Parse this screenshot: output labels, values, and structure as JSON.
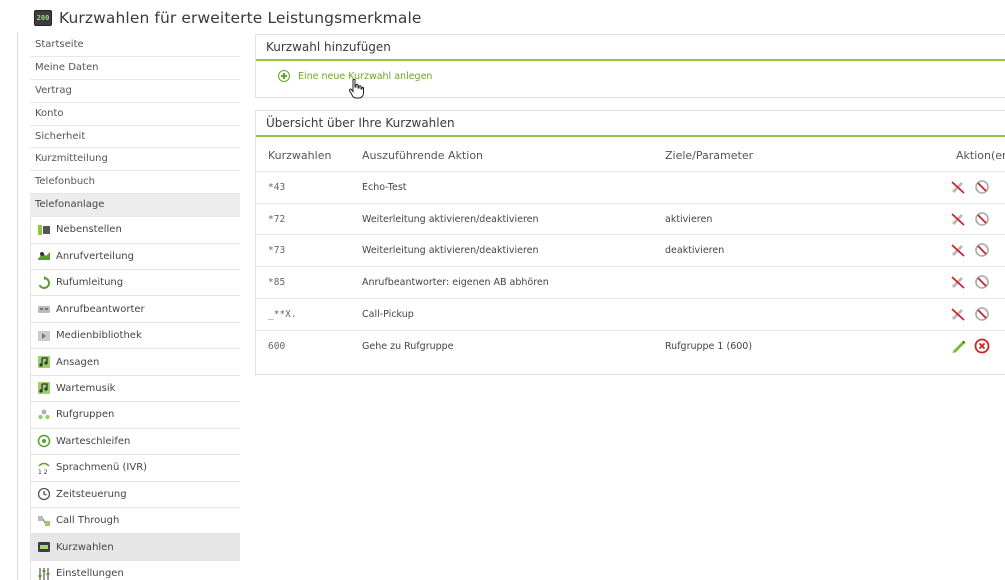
{
  "page": {
    "icon_text": "200",
    "title": "Kurzwahlen für erweiterte Leistungsmerkmale"
  },
  "sidebar": {
    "items": [
      {
        "label": "Startseite"
      },
      {
        "label": "Meine Daten"
      },
      {
        "label": "Vertrag"
      },
      {
        "label": "Konto"
      },
      {
        "label": "Sicherheit"
      },
      {
        "label": "Kurzmitteilung"
      },
      {
        "label": "Telefonbuch"
      },
      {
        "label": "Telefonanlage"
      }
    ],
    "sub_items": [
      {
        "label": "Nebenstellen",
        "icon": "extension-icon"
      },
      {
        "label": "Anrufverteilung",
        "icon": "call-distribution-icon"
      },
      {
        "label": "Rufumleitung",
        "icon": "call-forwarding-icon"
      },
      {
        "label": "Anrufbeantworter",
        "icon": "answering-machine-icon"
      },
      {
        "label": "Medienbibliothek",
        "icon": "media-library-icon"
      },
      {
        "label": "Ansagen",
        "icon": "announcement-icon"
      },
      {
        "label": "Wartemusik",
        "icon": "hold-music-icon"
      },
      {
        "label": "Rufgruppen",
        "icon": "call-group-icon"
      },
      {
        "label": "Warteschleifen",
        "icon": "queue-icon"
      },
      {
        "label": "Sprachmenü (IVR)",
        "icon": "ivr-icon"
      },
      {
        "label": "Zeitsteuerung",
        "icon": "clock-icon"
      },
      {
        "label": "Call Through",
        "icon": "call-through-icon"
      },
      {
        "label": "Kurzwahlen",
        "icon": "speed-dial-icon"
      },
      {
        "label": "Einstellungen",
        "icon": "settings-icon"
      }
    ],
    "active_sub": "Kurzwahlen"
  },
  "add_panel": {
    "title": "Kurzwahl hinzufügen",
    "add_link": "Eine neue Kurzwahl anlegen"
  },
  "list_panel": {
    "title": "Übersicht über Ihre Kurzwahlen",
    "headers": [
      "Kurzwahlen",
      "Auszuführende Aktion",
      "Ziele/Parameter",
      "Aktion(en)"
    ],
    "rows": [
      {
        "code": "*43",
        "action": "Echo-Test",
        "param": "",
        "editable": false
      },
      {
        "code": "*72",
        "action": "Weiterleitung aktivieren/deaktivieren",
        "param": "aktivieren",
        "editable": false
      },
      {
        "code": "*73",
        "action": "Weiterleitung aktivieren/deaktivieren",
        "param": "deaktivieren",
        "editable": false
      },
      {
        "code": "*85",
        "action": "Anrufbeantworter: eigenen AB abhören",
        "param": "",
        "editable": false
      },
      {
        "code": "_**X.",
        "action": "Call-Pickup",
        "param": "",
        "editable": false
      },
      {
        "code": "600",
        "action": "Gehe zu Rufgruppe",
        "param": "Rufgruppe 1 (600)",
        "editable": true
      }
    ]
  },
  "colors": {
    "accent_green": "#8dc63f",
    "link_green": "#6aaa1e",
    "delete_red": "#d0202a"
  }
}
